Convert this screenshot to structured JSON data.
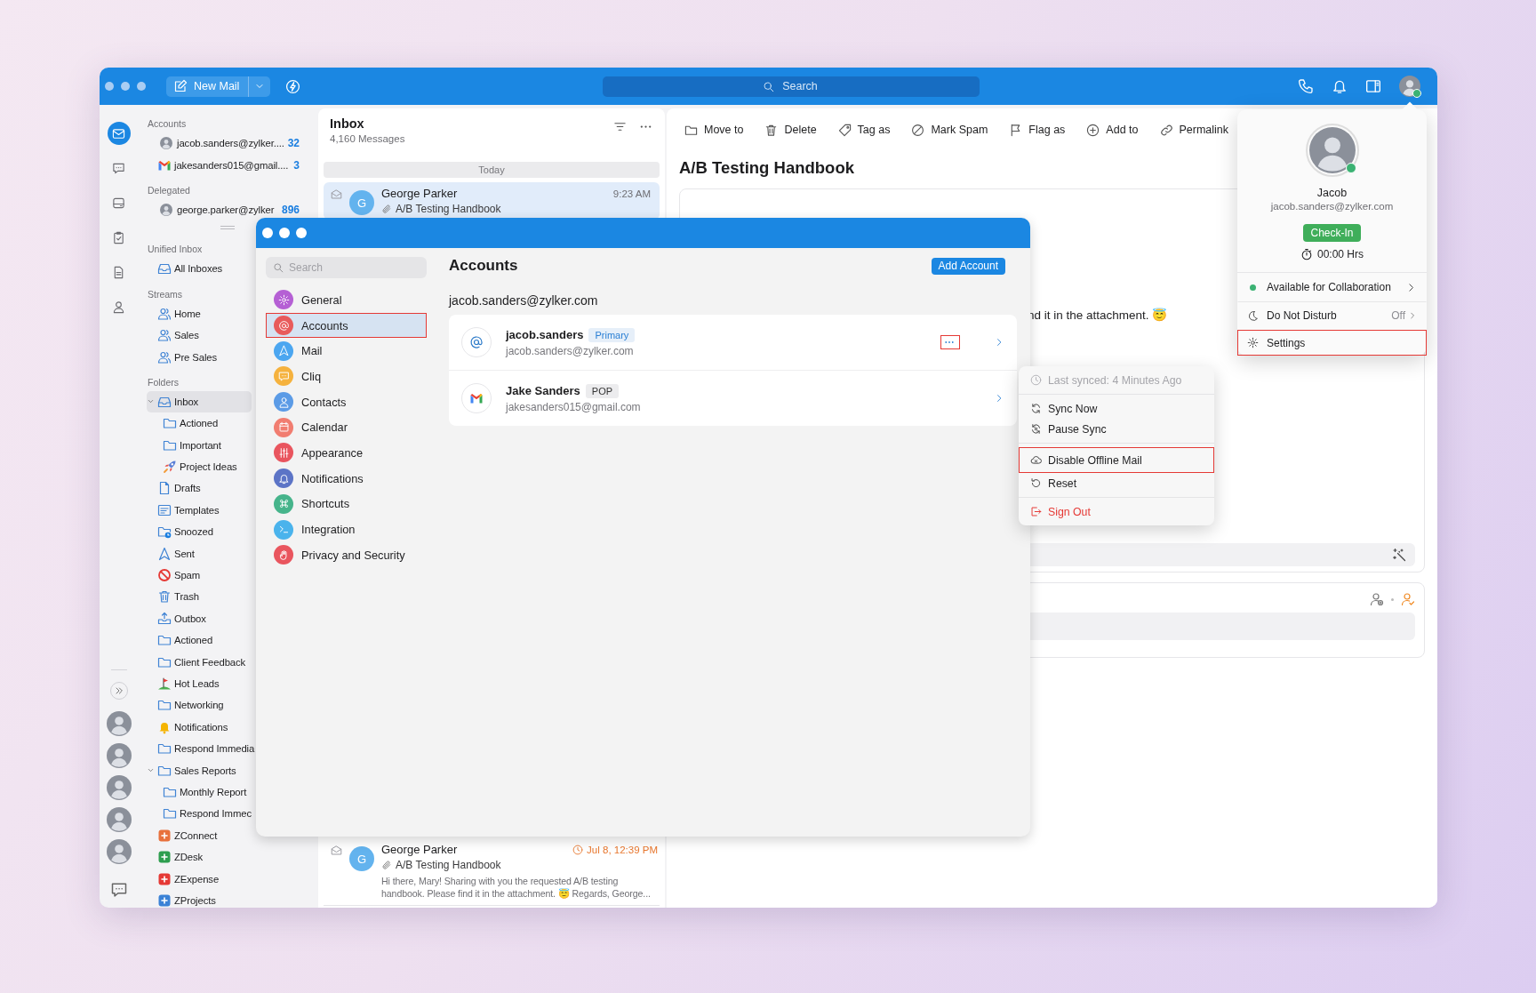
{
  "topbar": {
    "new_mail": "New Mail",
    "search": {
      "placeholder": "Search"
    }
  },
  "rail": {
    "apps": [
      {
        "kind": "mail",
        "selected": true
      },
      {
        "kind": "chat",
        "selected": false
      },
      {
        "kind": "drive",
        "selected": false
      },
      {
        "kind": "tasks",
        "selected": false
      },
      {
        "kind": "notes",
        "selected": false
      },
      {
        "kind": "contacts",
        "selected": false
      }
    ]
  },
  "folders": {
    "sections": [
      {
        "title": "Accounts",
        "items": [
          {
            "kind": "photo",
            "label": "jacob.sanders@zylker....",
            "count": "32",
            "selected": false
          },
          {
            "kind": "gmail",
            "label": "jakesanders015@gmail....",
            "count": "3",
            "selected": false
          }
        ]
      },
      {
        "title": "Delegated",
        "handle_after": true,
        "items": [
          {
            "kind": "photo",
            "label": "george.parker@zylker",
            "count": "896",
            "selected": false
          }
        ]
      },
      {
        "title": "Unified Inbox",
        "items": [
          {
            "kind": "inbox",
            "label": "All Inboxes",
            "selected": false
          }
        ]
      },
      {
        "title": "Streams",
        "items": [
          {
            "kind": "stream",
            "label": "Home",
            "selected": false
          },
          {
            "kind": "stream",
            "label": "Sales",
            "selected": false
          },
          {
            "kind": "stream",
            "label": "Pre Sales",
            "selected": false
          }
        ]
      },
      {
        "title": "Folders",
        "items": [
          {
            "kind": "inbox",
            "label": "Inbox",
            "selected": true,
            "expanded": true,
            "children": [
              {
                "kind": "folder",
                "label": "Actioned",
                "selected": false
              },
              {
                "kind": "folder",
                "label": "Important",
                "selected": false
              },
              {
                "kind": "rocket",
                "label": "Project Ideas",
                "selected": false
              }
            ]
          },
          {
            "kind": "drafts",
            "label": "Drafts",
            "selected": false
          },
          {
            "kind": "templates",
            "label": "Templates",
            "selected": false
          },
          {
            "kind": "snoozed",
            "label": "Snoozed",
            "selected": false
          },
          {
            "kind": "sent",
            "label": "Sent",
            "selected": false
          },
          {
            "kind": "spam",
            "label": "Spam",
            "selected": false
          },
          {
            "kind": "trash",
            "label": "Trash",
            "selected": false
          },
          {
            "kind": "outbox",
            "label": "Outbox",
            "selected": false
          },
          {
            "kind": "folder",
            "label": "Actioned",
            "selected": false
          },
          {
            "kind": "folder",
            "label": "Client Feedback",
            "selected": false
          },
          {
            "kind": "flag",
            "label": "Hot Leads",
            "selected": false
          },
          {
            "kind": "folder",
            "label": "Networking",
            "selected": false
          },
          {
            "kind": "bell",
            "label": "Notifications",
            "selected": false
          },
          {
            "kind": "folder",
            "label": "Respond Immedia",
            "selected": false
          },
          {
            "kind": "folder",
            "label": "Sales Reports",
            "selected": false,
            "expanded": true,
            "children": [
              {
                "kind": "folder",
                "label": "Monthly Report",
                "selected": false
              },
              {
                "kind": "folder",
                "label": "Respond Immec",
                "selected": false
              }
            ]
          }
        ]
      },
      {
        "items": [
          {
            "kind": "app",
            "label": "ZConnect",
            "color": "#e8713c",
            "selected": false
          },
          {
            "kind": "app",
            "label": "ZDesk",
            "color": "#2e9e4f",
            "selected": false
          },
          {
            "kind": "app",
            "label": "ZExpense",
            "color": "#e53935",
            "selected": false
          },
          {
            "kind": "app",
            "label": "ZProjects",
            "color": "#3b82d6",
            "selected": false
          }
        ]
      }
    ]
  },
  "mail_list": {
    "title": "Inbox",
    "subtitle": "4,160 Messages",
    "group": "Today",
    "messages": [
      {
        "avatar": "G",
        "sender": "George Parker",
        "time": "9:23 AM",
        "reminder": false,
        "subject": "A/B Testing Handbook",
        "selected": true
      },
      {
        "avatar": "G",
        "sender": "George Parker",
        "time": "Jul 8, 12:39 PM",
        "reminder": true,
        "subject": "A/B Testing Handbook",
        "preview": "Hi there, Mary! Sharing with you the requested A/B testing handbook. Please find it in the attachment. 😇 Regards, George...",
        "selected": false
      }
    ]
  },
  "reading": {
    "toolbar": [
      {
        "kind": "move",
        "label": "Move to"
      },
      {
        "kind": "delete",
        "label": "Delete"
      },
      {
        "kind": "tag",
        "label": "Tag as"
      },
      {
        "kind": "spam",
        "label": "Mark Spam"
      },
      {
        "kind": "flag",
        "label": "Flag as"
      },
      {
        "kind": "add",
        "label": "Add to"
      },
      {
        "kind": "permalink",
        "label": "Permalink"
      }
    ],
    "subject": "A/B Testing Handbook",
    "body_fragment": "nd it in the attachment. 😇"
  },
  "settings": {
    "search": {
      "placeholder": "Search"
    },
    "nav": [
      {
        "kind": "general",
        "label": "General",
        "color": "#b560d4",
        "selected": false,
        "highlighted": false
      },
      {
        "kind": "accounts",
        "label": "Accounts",
        "color": "#e85b5b",
        "selected": true,
        "highlighted": true
      },
      {
        "kind": "mail",
        "label": "Mail",
        "color": "#4ba6f0",
        "selected": false,
        "highlighted": false
      },
      {
        "kind": "cliq",
        "label": "Cliq",
        "color": "#f5b23e",
        "selected": false,
        "highlighted": false
      },
      {
        "kind": "contacts",
        "label": "Contacts",
        "color": "#5b9be6",
        "selected": false,
        "highlighted": false
      },
      {
        "kind": "calendar",
        "label": "Calendar",
        "color": "#f17d70",
        "selected": false,
        "highlighted": false
      },
      {
        "kind": "appearance",
        "label": "Appearance",
        "color": "#e9555e",
        "selected": false,
        "highlighted": false
      },
      {
        "kind": "notifications",
        "label": "Notifications",
        "color": "#5c74c6",
        "selected": false,
        "highlighted": false
      },
      {
        "kind": "shortcuts",
        "label": "Shortcuts",
        "color": "#46b48b",
        "selected": false,
        "highlighted": false
      },
      {
        "kind": "integration",
        "label": "Integration",
        "color": "#4ab3ec",
        "selected": false,
        "highlighted": false
      },
      {
        "kind": "privacy",
        "label": "Privacy and Security",
        "color": "#e9555e",
        "selected": false,
        "highlighted": false
      }
    ],
    "heading": "Accounts",
    "add_button": "Add Account",
    "section_title": "jacob.sanders@zylker.com",
    "accounts": [
      {
        "kind": "zoho",
        "name": "jacob.sanders",
        "tag": "Primary",
        "primary": true,
        "email": "jacob.sanders@zylker.com",
        "more": {
          "highlighted": true
        }
      },
      {
        "kind": "gmail",
        "name": "Jake Sanders",
        "tag": "POP",
        "primary": false,
        "email": "jakesanders015@gmail.com"
      }
    ]
  },
  "account_menu": {
    "groups": [
      {
        "items": [
          {
            "kind": "last-synced",
            "label": "Last synced: 4 Minutes Ago",
            "disabled": true,
            "highlighted": false
          }
        ]
      },
      {
        "items": [
          {
            "kind": "sync",
            "label": "Sync Now",
            "disabled": false,
            "highlighted": false
          },
          {
            "kind": "pause-sync",
            "label": "Pause Sync",
            "disabled": false,
            "highlighted": false
          }
        ]
      },
      {
        "items": [
          {
            "kind": "offline",
            "label": "Disable Offline Mail",
            "disabled": false,
            "highlighted": true
          },
          {
            "kind": "reset",
            "label": "Reset",
            "disabled": false,
            "highlighted": false
          }
        ]
      },
      {
        "items": [
          {
            "kind": "sign-out",
            "label": "Sign Out",
            "disabled": false,
            "highlighted": false
          }
        ]
      }
    ]
  },
  "profile": {
    "name": "Jacob",
    "email": "jacob.sanders@zylker.com",
    "online": true,
    "check_in": "Check-In",
    "timer": "00:00 Hrs",
    "items": [
      {
        "kind": "availability",
        "label": "Available for Collaboration",
        "highlighted": false
      },
      {
        "kind": "dnd",
        "label": "Do Not Disturb",
        "value": "Off",
        "highlighted": false
      },
      {
        "kind": "settings",
        "label": "Settings",
        "highlighted": true
      }
    ]
  }
}
